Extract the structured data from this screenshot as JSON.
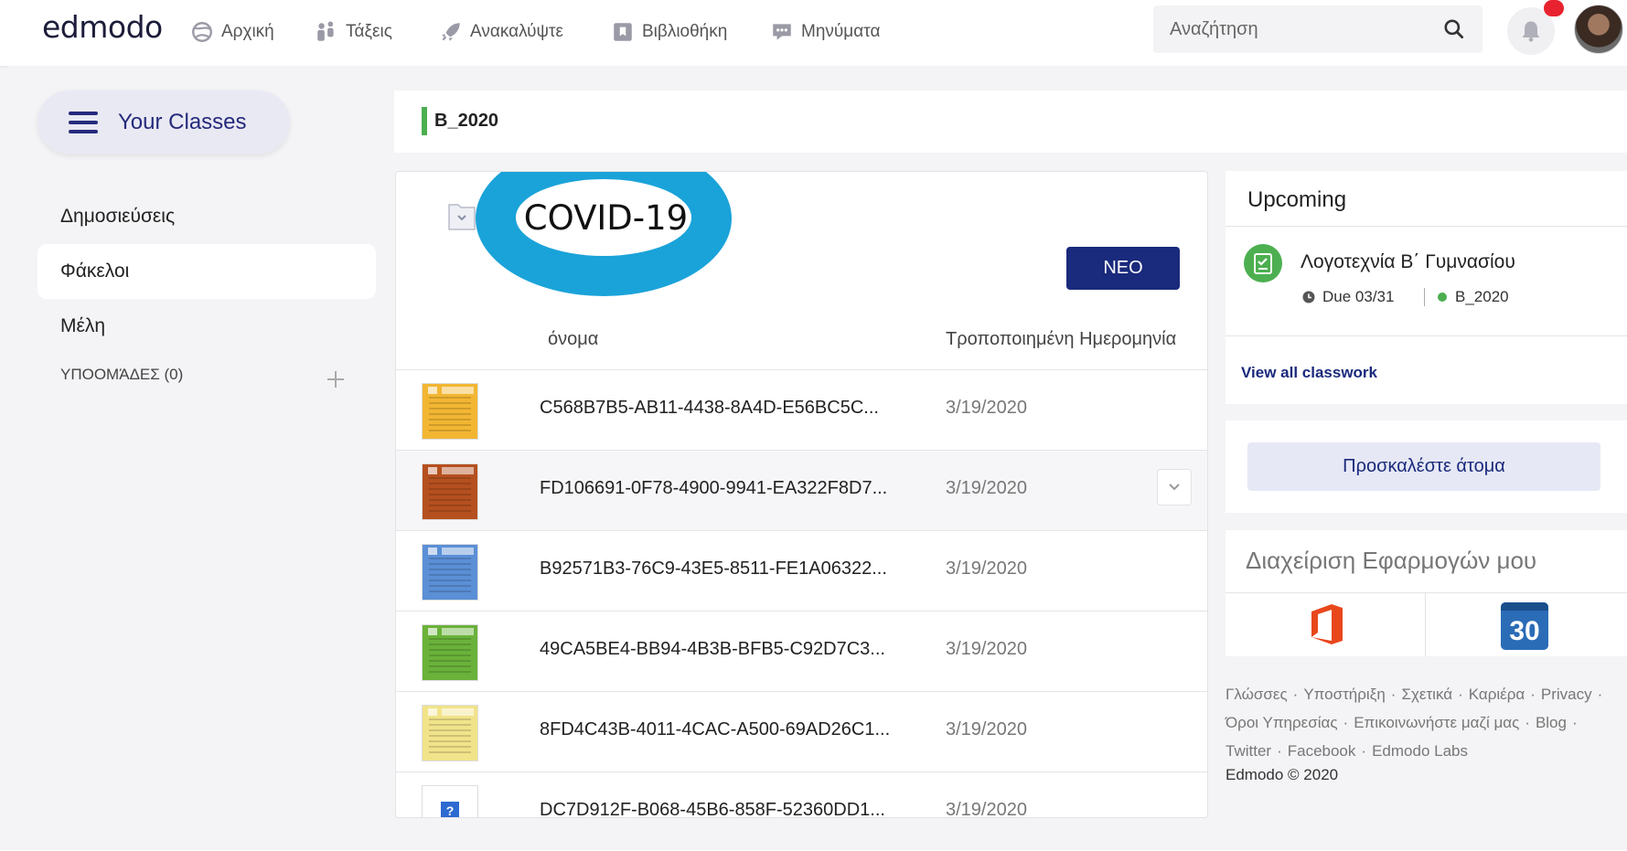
{
  "nav": {
    "logo": "edmodo",
    "items": [
      {
        "label": "Αρχική",
        "icon": "home-icon"
      },
      {
        "label": "Τάξεις",
        "icon": "classes-icon"
      },
      {
        "label": "Ανακαλύψτε",
        "icon": "rocket-icon"
      },
      {
        "label": "Βιβλιοθήκη",
        "icon": "library-icon"
      },
      {
        "label": "Μηνύματα",
        "icon": "messages-icon"
      }
    ],
    "search_placeholder": "Αναζήτηση"
  },
  "sidebar": {
    "your_classes": "Your Classes",
    "items": [
      {
        "label": "Δημοσιεύσεις"
      },
      {
        "label": "Φάκελοι",
        "active": true
      },
      {
        "label": "Μέλη"
      }
    ],
    "subgroups": "ΥΠΟΟΜΆΔΕΣ (0)"
  },
  "class_header": {
    "name": "B_2020",
    "accent": "#4caf50"
  },
  "folder": {
    "title": "COVID-19",
    "new_button": "ΝΕΟ",
    "col_name": "όνομα",
    "col_date": "Τροποποιημένη Ημερομηνία",
    "files": [
      {
        "name": "C568B7B5-AB11-4438-8A4D-E56BC5C...",
        "date": "3/19/2020",
        "thumb_color": "#f2b632"
      },
      {
        "name": "FD106691-0F78-4900-9941-EA322F8D7...",
        "date": "3/19/2020",
        "thumb_color": "#b5501f"
      },
      {
        "name": "B92571B3-76C9-43E5-8511-FE1A06322...",
        "date": "3/19/2020",
        "thumb_color": "#5b8fd6"
      },
      {
        "name": "49CA5BE4-BB94-4B3B-BFB5-C92D7C3...",
        "date": "3/19/2020",
        "thumb_color": "#6ab23a"
      },
      {
        "name": "8FD4C43B-4011-4CAC-A500-69AD26C1...",
        "date": "3/19/2020",
        "thumb_color": "#f1e38a"
      },
      {
        "name": "DC7D912F-B068-45B6-858F-52360DD1...",
        "date": "3/19/2020",
        "thumb_color": "#ffffff"
      }
    ]
  },
  "upcoming": {
    "title": "Upcoming",
    "item_title": "Λογοτεχνία Β΄ Γυμνασίου",
    "due": "Due 03/31",
    "class": "B_2020",
    "view_all": "View all classwork"
  },
  "invite_button": "Προσκαλέστε άτομα",
  "apps": {
    "title": "Διαχείριση Εφαρμογών μου",
    "calendar_day": "30"
  },
  "footer": {
    "links": [
      "Γλώσσες",
      "Υποστήριξη",
      "Σχετικά",
      "Καριέρα",
      "Privacy",
      "Όροι Υπηρεσίας",
      "Επικοινωνήστε μαζί μας",
      "Blog",
      "Twitter",
      "Facebook",
      "Edmodo Labs"
    ],
    "copyright": "Edmodo © 2020"
  },
  "colors": {
    "brand_navy": "#1a2a7c",
    "highlight_ring": "#1aa3d9",
    "notification": "#e8232f"
  }
}
